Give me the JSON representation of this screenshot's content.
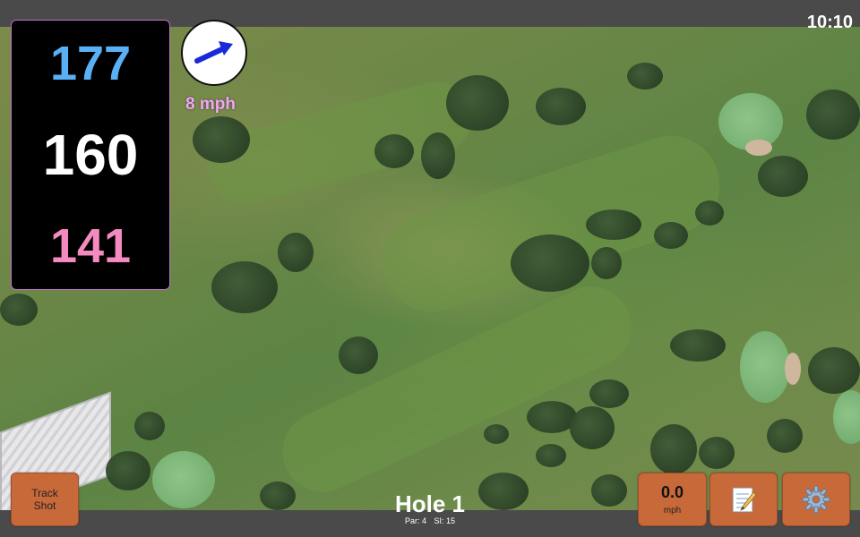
{
  "status": {
    "time": "10:10"
  },
  "distances": {
    "back": "177",
    "center": "160",
    "front": "141"
  },
  "wind": {
    "speed": "8 mph",
    "direction_icon": "wind-arrow-icon"
  },
  "hole": {
    "title": "Hole 1",
    "par": "Par: 4",
    "si": "SI: 15"
  },
  "buttons": {
    "track_shot_line1": "Track",
    "track_shot_line2": "Shot",
    "speed_value": "0.0",
    "speed_unit": "mph",
    "notes_icon": "notepad-icon",
    "settings_icon": "gear-icon"
  },
  "colors": {
    "back": "#5ab0f4",
    "center": "#ffffff",
    "front": "#f48ac0",
    "wind_text": "#f0a8f0",
    "button": "#c8693a",
    "arrow": "#1a2ad8"
  }
}
